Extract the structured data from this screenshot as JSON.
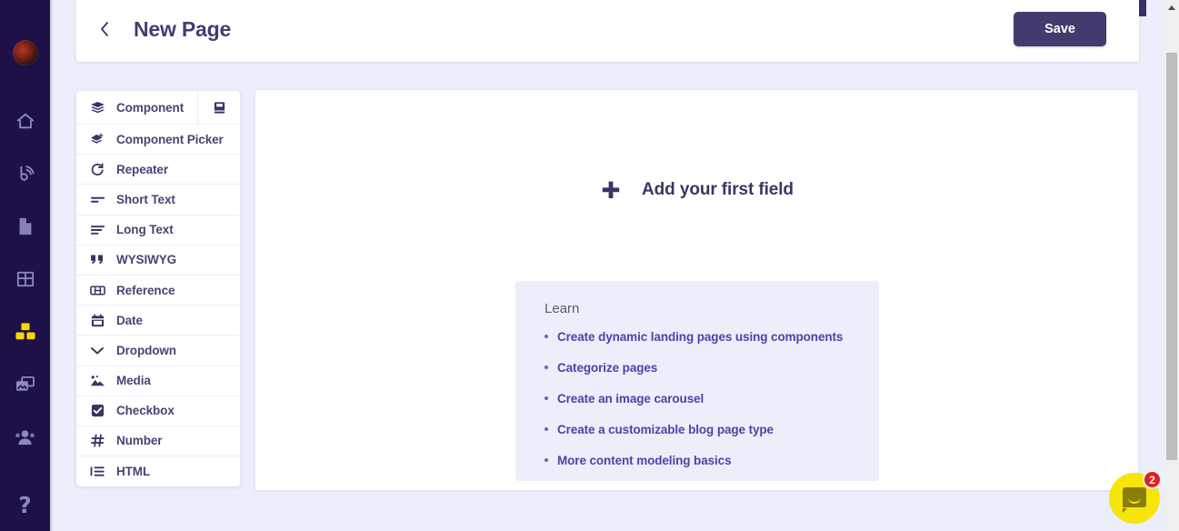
{
  "nav_rail": {
    "avatar": {
      "name": "user-avatar"
    },
    "items": [
      {
        "icon": "home-icon",
        "label": "Home",
        "active": false
      },
      {
        "icon": "blog-icon",
        "label": "Blog",
        "active": false
      },
      {
        "icon": "page-icon",
        "label": "Pages",
        "active": false
      },
      {
        "icon": "table-icon",
        "label": "Tables",
        "active": false
      },
      {
        "icon": "components-icon",
        "label": "Components",
        "active": true
      },
      {
        "icon": "media-icon",
        "label": "Media",
        "active": false
      },
      {
        "icon": "users-icon",
        "label": "Users",
        "active": false
      }
    ],
    "help": {
      "icon": "question-mark-icon",
      "label": "?"
    },
    "background_color": "#1d1148",
    "active_color": "#f5d800"
  },
  "header": {
    "back_icon": "chevron-left-icon",
    "title": "New Page",
    "save_label": "Save",
    "save_color": "#453a6e"
  },
  "field_sidebar": {
    "items": [
      {
        "label": "Component",
        "icon": "layers-icon",
        "aside_icon": "book-icon"
      },
      {
        "label": "Component Picker",
        "icon": "layers-plus-icon"
      },
      {
        "label": "Repeater",
        "icon": "refresh-icon"
      },
      {
        "label": "Short Text",
        "icon": "short-text-icon"
      },
      {
        "label": "Long Text",
        "icon": "long-text-icon"
      },
      {
        "label": "WYSIWYG",
        "icon": "quote-icon"
      },
      {
        "label": "Reference",
        "icon": "reference-icon"
      },
      {
        "label": "Date",
        "icon": "calendar-icon"
      },
      {
        "label": "Dropdown",
        "icon": "chevron-down-icon"
      },
      {
        "label": "Media",
        "icon": "image-icon"
      },
      {
        "label": "Checkbox",
        "icon": "checkbox-icon"
      },
      {
        "label": "Number",
        "icon": "hash-icon"
      },
      {
        "label": "HTML",
        "icon": "list-icon"
      }
    ]
  },
  "canvas": {
    "add_field": {
      "icon": "plus-icon",
      "label": "Add your first field"
    },
    "learn": {
      "title": "Learn",
      "links": [
        "Create dynamic landing pages using components",
        "Categorize pages",
        "Create an image carousel",
        "Create a customizable blog page type",
        "More content modeling basics"
      ]
    }
  },
  "chat_widget": {
    "icon": "chat-bubble-icon",
    "unread_count": "2",
    "color": "#f5e50a",
    "badge_color": "#e02020"
  },
  "scrollbar": {
    "up_icon": "scroll-up-arrow-icon"
  }
}
